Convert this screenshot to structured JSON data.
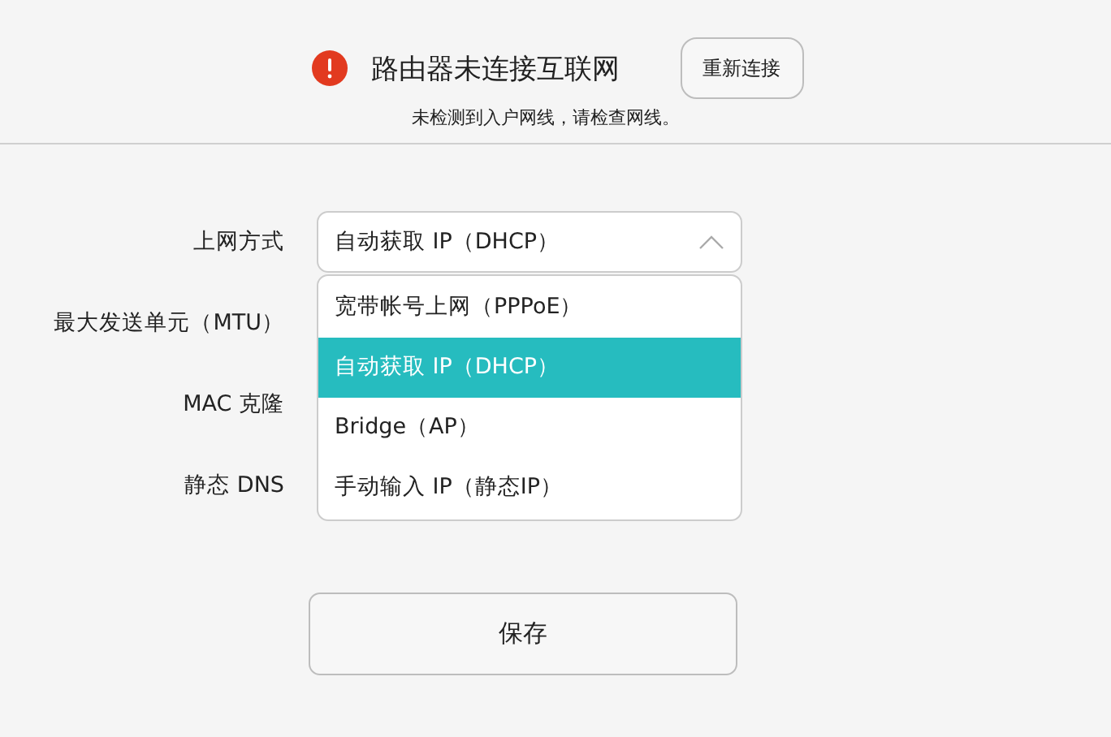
{
  "banner": {
    "title": "路由器未连接互联网",
    "reconnect_button": "重新连接",
    "message": "未检测到入户网线，请检查网线。"
  },
  "form": {
    "labels": [
      "上网方式",
      "最大发送单元（MTU）",
      "MAC 克隆",
      "静态 DNS"
    ],
    "connection_type": {
      "value": "自动获取 IP（DHCP）",
      "expanded": true,
      "options": [
        {
          "label": "宽带帐号上网（PPPoE）",
          "selected": false
        },
        {
          "label": "自动获取 IP（DHCP）",
          "selected": true
        },
        {
          "label": "Bridge（AP）",
          "selected": false
        },
        {
          "label": "手动输入 IP（静态IP）",
          "selected": false
        }
      ]
    }
  },
  "save_button": "保存"
}
